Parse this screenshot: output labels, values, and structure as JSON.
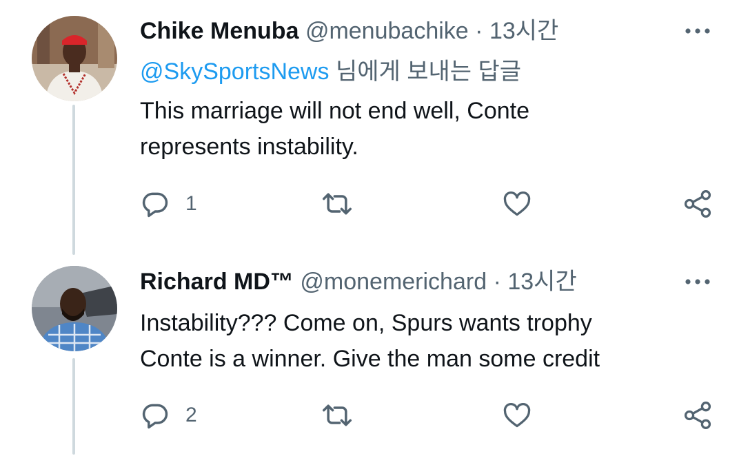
{
  "tweets": [
    {
      "name": "Chike Menuba",
      "handle": "@menubachike",
      "separator": "·",
      "time": "13시간",
      "reply_to_handle": "@SkySportsNews",
      "reply_to_suffix": "님에게 보내는 답글",
      "text_lines": [
        "This marriage will not end well, Conte",
        "represents instability."
      ],
      "reply_count": "1"
    },
    {
      "name": "Richard MD™",
      "handle": "@monemerichard",
      "separator": "·",
      "time": "13시간",
      "text_lines": [
        "Instability??? Come on, Spurs wants trophy",
        "Conte is a winner. Give the man some credit"
      ],
      "reply_count": "2"
    }
  ],
  "icons": {
    "reply": "reply-icon",
    "retweet": "retweet-icon",
    "like": "heart-icon",
    "share": "share-icon",
    "more": "more-icon"
  },
  "colors": {
    "accent": "#1d9bf0",
    "secondary_text": "#536471",
    "thread_line": "#cfd9de"
  }
}
